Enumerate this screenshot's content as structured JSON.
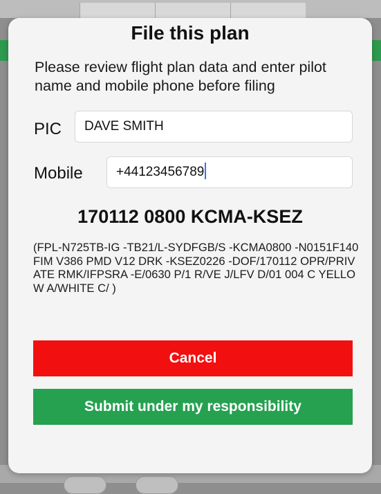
{
  "dialog": {
    "title": "File this plan",
    "message": "Please review flight plan data and enter pilot name and mobile phone before filing",
    "pic_label": "PIC",
    "pic_value": "DAVE SMITH",
    "mobile_label": "Mobile",
    "mobile_value": "+44123456789",
    "plan_heading": "170112 0800 KCMA-KSEZ",
    "plan_text": "(FPL-N725TB-IG -TB21/L-SYDFGB/S -KCMA0800 -N0151F140 FIM V386 PMD V12 DRK -KSEZ0226 -DOF/170112 OPR/PRIVATE RMK/IFPSRA -E/0630 P/1 R/VE J/LFV D/01 004 C YELLOW A/WHITE C/ )",
    "cancel_label": "Cancel",
    "submit_label": "Submit under my responsibility"
  },
  "colors": {
    "cancel": "#f20f0f",
    "submit": "#25a150",
    "caret": "#3c6ff0"
  }
}
